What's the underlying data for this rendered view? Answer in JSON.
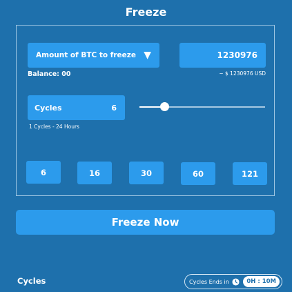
{
  "header": {
    "title": "Freeze"
  },
  "freeze_panel": {
    "asset_dropdown_label": "Amount of BTC to freeze",
    "dropdown_arrow": "▼",
    "amount_value": "1230976",
    "usd_estimate": "~ $ 1230976 USD",
    "balance_text": "Balance: 00",
    "cycles_label": "Cycles",
    "cycles_value": "6",
    "cycles_note": "1 Cycles - 24 Hours",
    "slider_level": 0.2,
    "presets": [
      "6",
      "16",
      "30",
      "60",
      "121"
    ]
  },
  "action": {
    "freeze_now_label": "Freeze Now"
  },
  "footer": {
    "label": "Cycles",
    "ends_label": "Cycles Ends in",
    "ends_time": "0H : 10M"
  },
  "colors": {
    "background": "#1e70ac",
    "button": "#2c9bec",
    "text": "#ffffff"
  },
  "icons": {
    "dropdown": "triangle-down-icon",
    "timer": "clock-icon"
  }
}
